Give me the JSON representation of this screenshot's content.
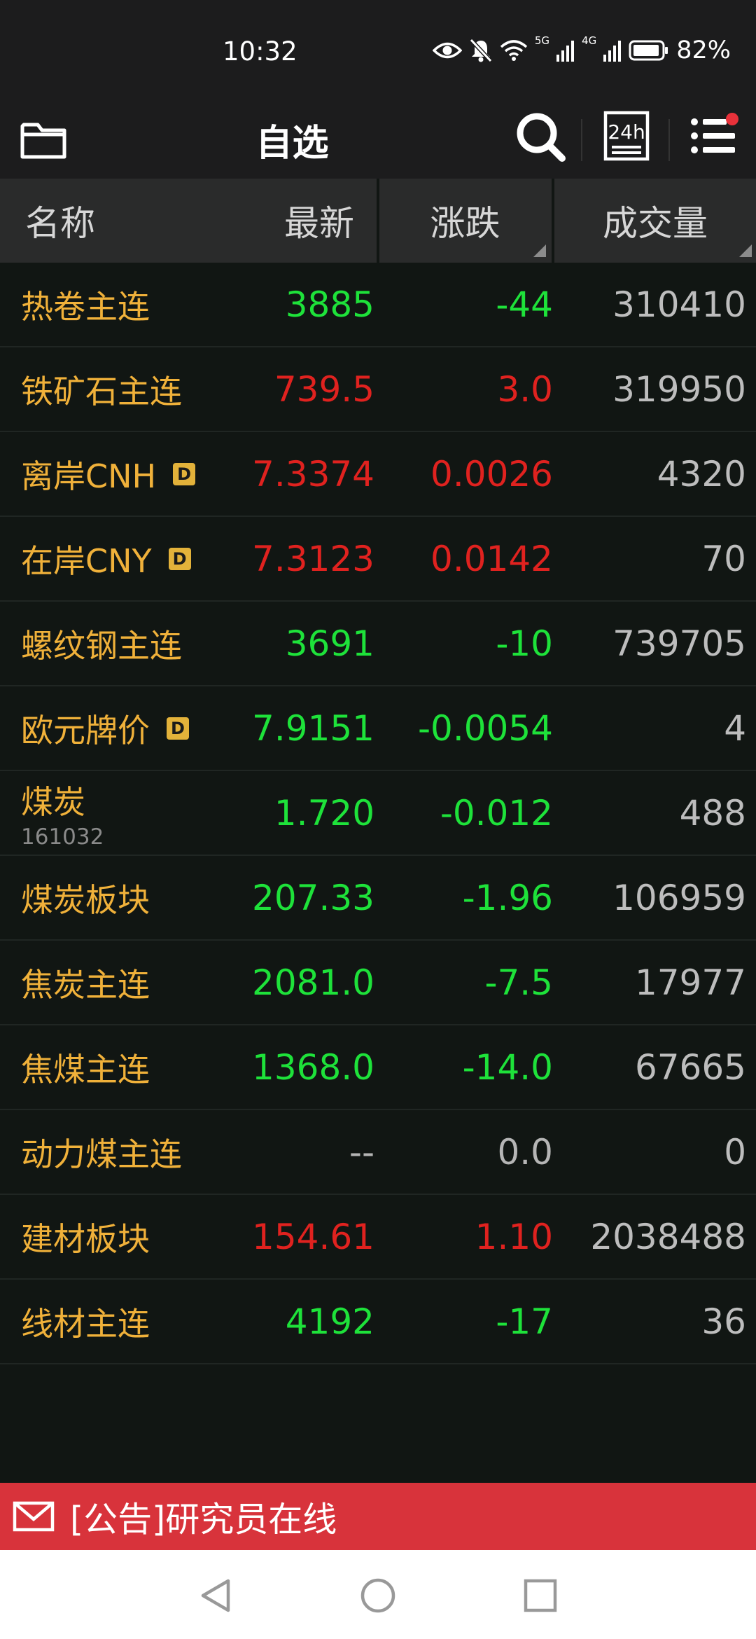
{
  "status": {
    "time": "10:32",
    "net1": "5G",
    "net2": "4G",
    "battery": "82%"
  },
  "header": {
    "title": "自选"
  },
  "icons": {
    "h24_label": "24h"
  },
  "columns": {
    "name": "名称",
    "latest": "最新",
    "change": "涨跌",
    "volume": "成交量"
  },
  "rows": [
    {
      "name": "热卷主连",
      "latest": "3885",
      "change": "-44",
      "volume": "310410",
      "trend": "down"
    },
    {
      "name": "铁矿石主连",
      "latest": "739.5",
      "change": "3.0",
      "volume": "319950",
      "trend": "up"
    },
    {
      "name": "离岸CNH",
      "badge": "D",
      "latest": "7.3374",
      "change": "0.0026",
      "volume": "4320",
      "trend": "up"
    },
    {
      "name": "在岸CNY",
      "badge": "D",
      "latest": "7.3123",
      "change": "0.0142",
      "volume": "70",
      "trend": "up"
    },
    {
      "name": "螺纹钢主连",
      "latest": "3691",
      "change": "-10",
      "volume": "739705",
      "trend": "down"
    },
    {
      "name": "欧元牌价",
      "badge": "D",
      "latest": "7.9151",
      "change": "-0.0054",
      "volume": "4",
      "trend": "down"
    },
    {
      "name": "煤炭",
      "code": "161032",
      "latest": "1.720",
      "change": "-0.012",
      "volume": "488",
      "trend": "down"
    },
    {
      "name": "煤炭板块",
      "latest": "207.33",
      "change": "-1.96",
      "volume": "106959",
      "trend": "down"
    },
    {
      "name": "焦炭主连",
      "latest": "2081.0",
      "change": "-7.5",
      "volume": "17977",
      "trend": "down"
    },
    {
      "name": "焦煤主连",
      "latest": "1368.0",
      "change": "-14.0",
      "volume": "67665",
      "trend": "down"
    },
    {
      "name": "动力煤主连",
      "latest": "--",
      "change": "0.0",
      "volume": "0",
      "trend": "flat"
    },
    {
      "name": "建材板块",
      "latest": "154.61",
      "change": "1.10",
      "volume": "2038488",
      "trend": "up"
    },
    {
      "name": "线材主连",
      "latest": "4192",
      "change": "-17",
      "volume": "36",
      "trend": "down"
    }
  ],
  "notice": {
    "text": "[公告]研究员在线"
  },
  "colors": {
    "up": "#e0221f",
    "down": "#1ee23a",
    "name": "#f0b13a",
    "notice_bg": "#d8333b"
  }
}
